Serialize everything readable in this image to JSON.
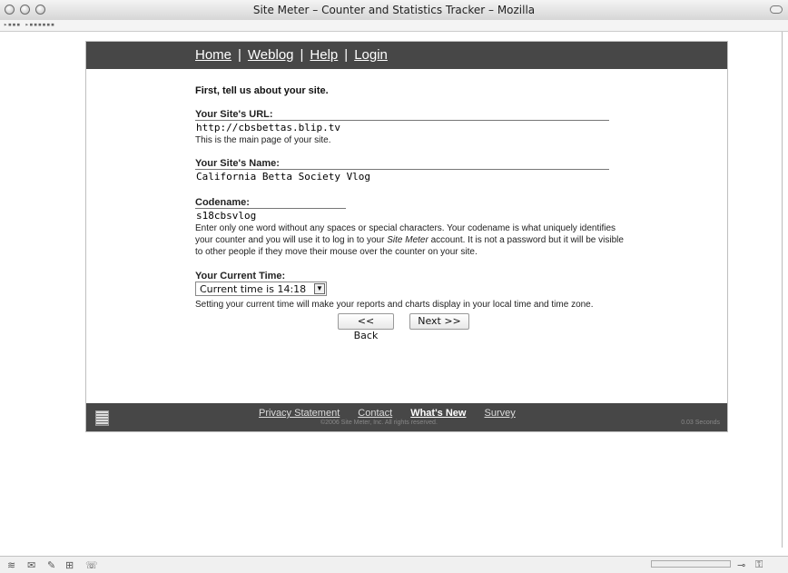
{
  "window": {
    "title": "Site Meter – Counter and Statistics Tracker – Mozilla",
    "status_text": "▸▪▪▪ ▸▪▪▪▪▪▪"
  },
  "nav": {
    "home": "Home",
    "weblog": "Weblog",
    "help": "Help",
    "login": "Login",
    "separator": "|"
  },
  "form": {
    "intro": "First, tell us about your site.",
    "url": {
      "label": "Your Site's URL:",
      "value": "http://cbsbettas.blip.tv",
      "help": "This is the main page of your site."
    },
    "name": {
      "label": "Your Site's Name:",
      "value": "California Betta Society Vlog"
    },
    "codename": {
      "label": "Codename:",
      "value": "s18cbsvlog",
      "help_before": "Enter only one word without any spaces or special characters. Your codename is what uniquely identifies your counter and you will use it to log in to your ",
      "help_emphasis": "Site Meter",
      "help_after": " account. It is not a password but it will be visible to other people if they move their mouse over the counter on your site."
    },
    "time": {
      "label": "Your Current Time:",
      "selected": "Current time is 14:18",
      "help": "Setting your current time will make your reports and charts display in your local time and time zone."
    },
    "back_label": "<< Back",
    "next_label": "Next >>"
  },
  "footer": {
    "privacy": "Privacy Statement",
    "contact": "Contact",
    "whats_new": "What's New",
    "survey": "Survey",
    "copyright": "©2006 Site Meter, Inc. All rights reserved.",
    "timing": "0.03 Seconds"
  },
  "icons": [
    "traffic-light-icon",
    "list-icon",
    "wand-icon",
    "mail-icon",
    "pen-icon",
    "editor-icon",
    "chat-icon",
    "connection-icon",
    "lock-icon"
  ]
}
